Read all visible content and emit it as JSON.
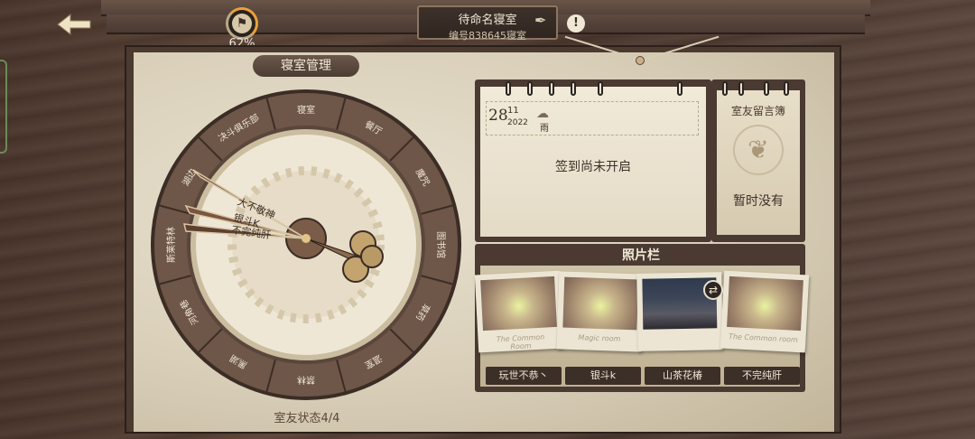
{
  "header": {
    "back_icon": "back-arrow-icon",
    "progress_percent": "62%",
    "progress_value": 0.62,
    "room_title": "待命名寝室",
    "room_number": "编号838645寝室",
    "edit_icon": "quill-edit-icon",
    "info_icon": "!"
  },
  "dorm": {
    "section_title": "寝室管理",
    "wheel_labels": [
      "寝室",
      "餐厅",
      "魔咒",
      "图书馆",
      "草药",
      "温室",
      "禁林",
      "黑湖",
      "河角巷",
      "斯莱特林",
      "湖边",
      "决斗俱乐部"
    ],
    "hands": [
      "大不敬神",
      "银斗K",
      "不完纯肝"
    ],
    "roommate_status": "室友状态4/4"
  },
  "calendar": {
    "day": "28",
    "month": "11",
    "year": "2022",
    "weather_label": "雨",
    "checkin_status": "签到尚未开启"
  },
  "message_board": {
    "title": "室友留言簿",
    "empty_text": "暂时没有"
  },
  "photo_bar": {
    "title": "照片栏",
    "swap_icon": "swap-icon",
    "photos": [
      {
        "caption": "The Common Room"
      },
      {
        "caption": "Magic room"
      },
      {
        "caption": ""
      },
      {
        "caption": "The Common room"
      }
    ],
    "names": [
      "玩世不恭丶",
      "银斗k",
      "山茶花椿",
      "不完纯肝"
    ]
  },
  "colors": {
    "accent_orange": "#e8a23a",
    "wood_dark": "#4a3a31",
    "paper": "#e9e2d0"
  }
}
